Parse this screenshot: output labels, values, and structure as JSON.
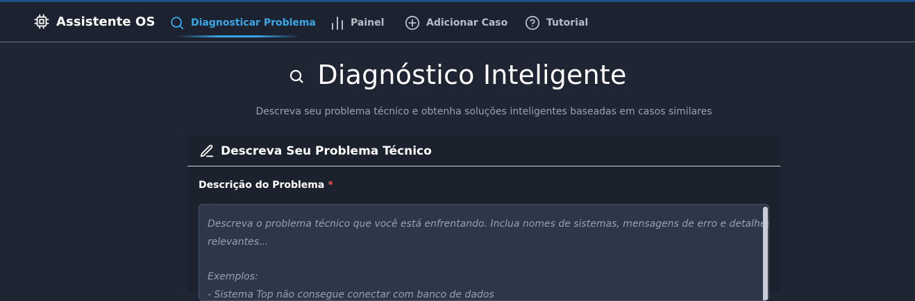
{
  "app": {
    "name": "Assistente OS",
    "icon": "cpu-chip-icon"
  },
  "nav": {
    "items": [
      {
        "label": "Diagnosticar Problema",
        "icon": "search-icon",
        "active": true
      },
      {
        "label": "Painel",
        "icon": "bar-chart-icon",
        "active": false
      },
      {
        "label": "Adicionar Caso",
        "icon": "plus-circle-icon",
        "active": false
      },
      {
        "label": "Tutorial",
        "icon": "question-circle-icon",
        "active": false
      }
    ]
  },
  "page": {
    "title": "Diagnóstico Inteligente",
    "title_icon": "search-icon",
    "subtitle": "Descreva seu problema técnico e obtenha soluções inteligentes baseadas em casos similares"
  },
  "form": {
    "card_title": "Descreva Seu Problema Técnico",
    "card_icon": "pencil-icon",
    "description_label": "Descrição do Problema",
    "required_marker": "*",
    "placeholder_lines": [
      "Descreva o problema técnico que você está enfrentando. Inclua nomes de sistemas, mensagens de erro e detalhes",
      "relevantes...",
      "",
      "Exemplos:",
      "- Sistema Top não consegue conectar com banco de dados"
    ]
  },
  "colors": {
    "background": "#1f2533",
    "navbar": "#1c2230",
    "accent": "#3aa8e8",
    "required": "#f05252",
    "textarea_bg": "#2e3748"
  }
}
